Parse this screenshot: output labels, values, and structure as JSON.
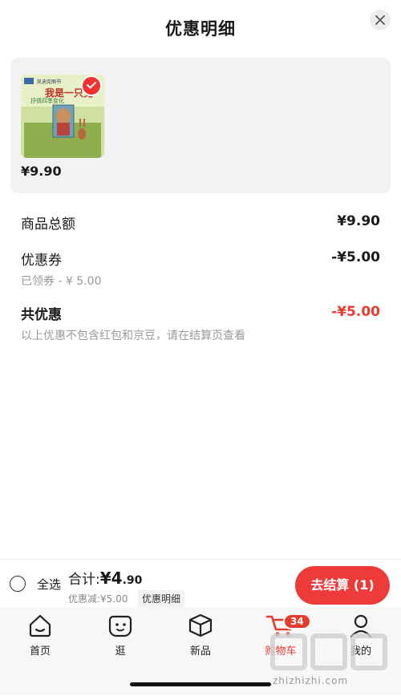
{
  "header": {
    "title": "优惠明细"
  },
  "product": {
    "price": "¥9.90",
    "cover_text": "我是一只兔",
    "cover_sub": "抒情四季变化",
    "publisher": "凯迪克图书"
  },
  "rows": {
    "goods_total_label": "商品总额",
    "goods_total_value": "¥9.90",
    "coupon_label": "优惠券",
    "coupon_value": "-¥5.00",
    "coupon_sub": "已领券 - ¥ 5.00",
    "total_discount_label": "共优惠",
    "total_discount_value": "-¥5.00",
    "note": "以上优惠不包含红包和京豆，请在结算页查看"
  },
  "bottom": {
    "select_all": "全选",
    "total_prefix": "合计:",
    "currency": "¥",
    "total_int": "4",
    "total_dec": ".90",
    "discount_text": "优惠减:¥5.00",
    "detail_label": "优惠明细",
    "checkout_label": "去结算 (1)"
  },
  "tabs": [
    {
      "label": "首页",
      "icon": "home-icon"
    },
    {
      "label": "逛",
      "icon": "browse-icon"
    },
    {
      "label": "新品",
      "icon": "box-icon"
    },
    {
      "label": "购物车",
      "icon": "cart-icon"
    },
    {
      "label": "我的",
      "icon": "user-icon"
    }
  ],
  "cart_badge": "34",
  "watermark": {
    "text": "zhizhizhi.com"
  },
  "colors": {
    "accent": "#e93b2d",
    "checkout": "#ef3a3a"
  }
}
